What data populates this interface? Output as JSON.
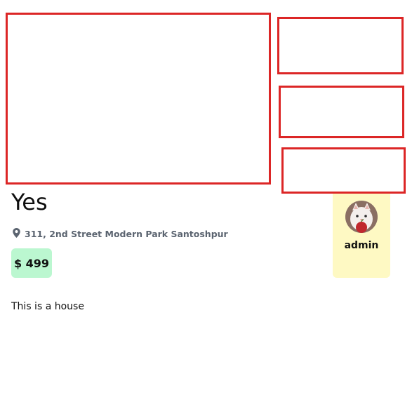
{
  "listing": {
    "title": "Yes",
    "address": "311, 2nd Street Modern Park Santoshpur",
    "price": "$ 499",
    "description": "This is a house"
  },
  "owner": {
    "name": "admin"
  },
  "icons": {
    "location": "map-pin-icon"
  },
  "colors": {
    "image_border": "#dc2626",
    "price_bg": "#bbf7d0",
    "owner_card_bg": "#fef9c3",
    "address_text": "#5b6470"
  }
}
